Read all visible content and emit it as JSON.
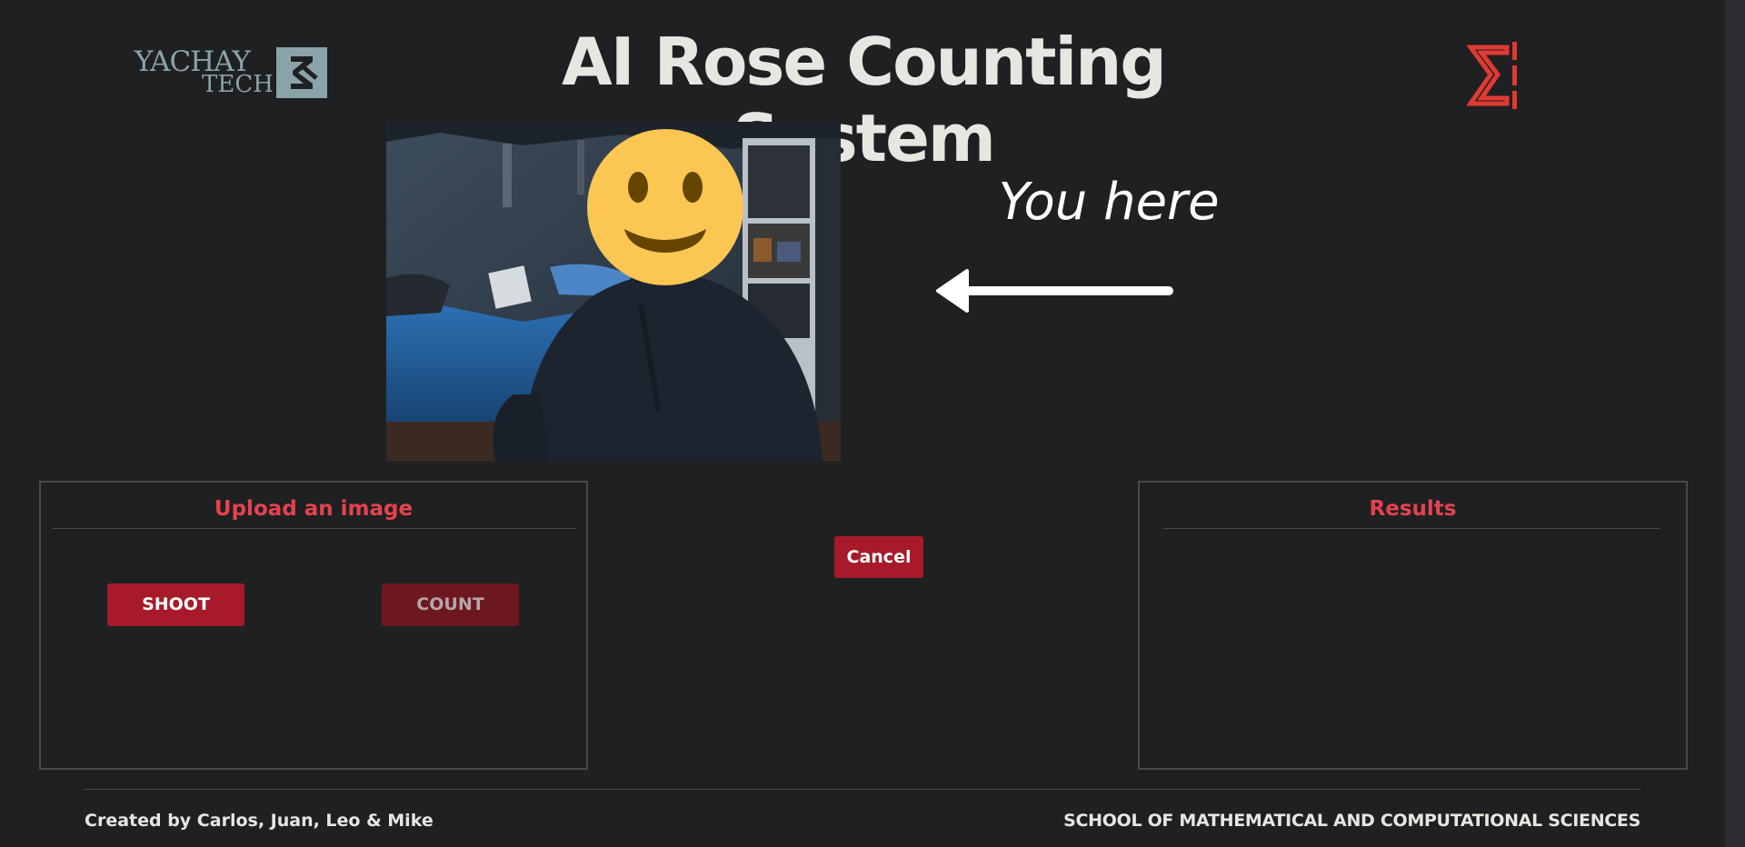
{
  "header": {
    "logo_left_line1": "YACHAY",
    "logo_left_line2": "TECH",
    "title": "AI Rose Counting System",
    "logo_right_icon": "sigma-logo-icon"
  },
  "camera": {
    "overlay_icon": "smiley-face-icon"
  },
  "pointer": {
    "label": "You here",
    "icon": "arrow-left-icon"
  },
  "upload_panel": {
    "title": "Upload an image",
    "shoot_label": "SHOOT",
    "count_label": "COUNT"
  },
  "center": {
    "cancel_label": "Cancel"
  },
  "results_panel": {
    "title": "Results"
  },
  "footer": {
    "credits": "Created by Carlos, Juan, Leo & Mike",
    "school": "SCHOOL OF MATHEMATICAL AND COMPUTATIONAL SCIENCES"
  },
  "colors": {
    "background": "#1f2022",
    "accent_red": "#a61a2a",
    "title_red": "#e5424e",
    "logo_teal": "#8aa3a8"
  }
}
